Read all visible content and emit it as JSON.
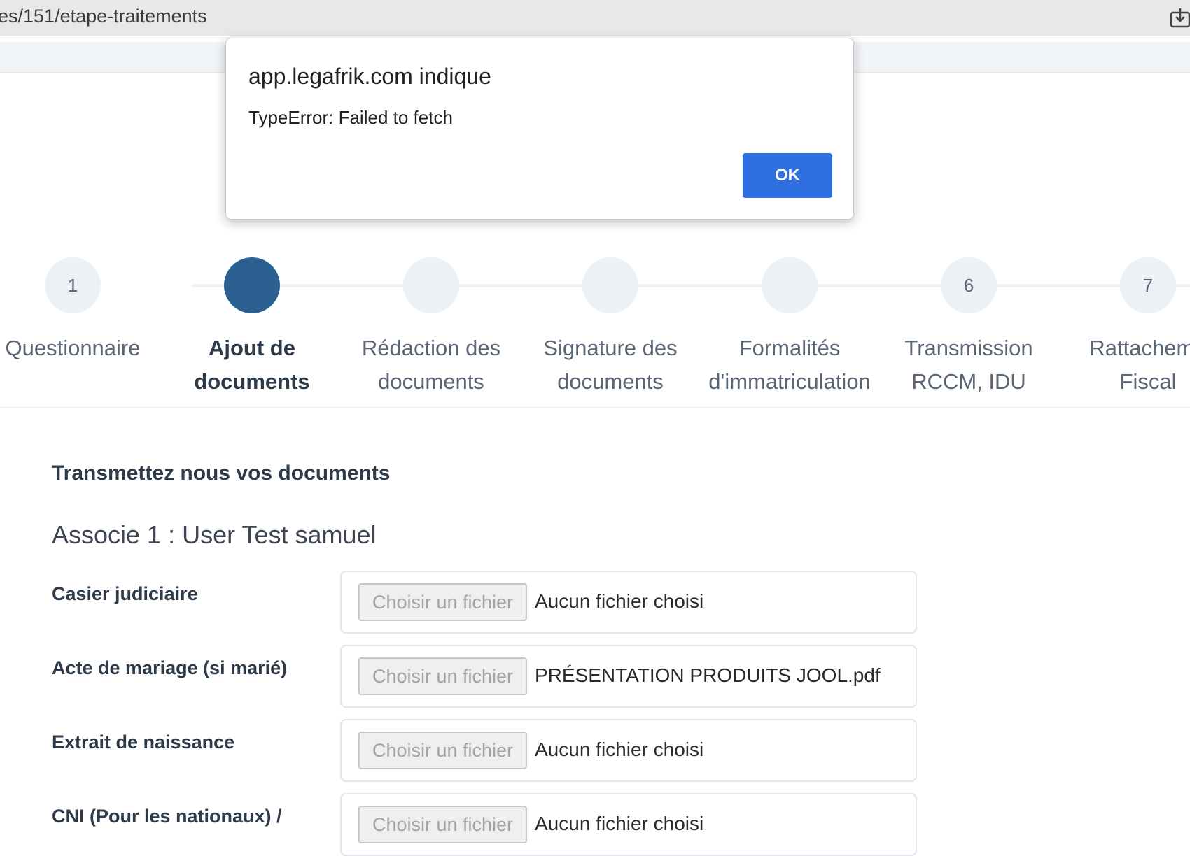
{
  "browser": {
    "url": "es/151/etape-traitements",
    "download_icon": "download-tray-icon"
  },
  "dialog": {
    "title": "app.legafrik.com indique",
    "message": "TypeError: Failed to fetch",
    "ok_label": "OK",
    "ok_color": "#2f6fdf"
  },
  "stepper": {
    "active_color": "#2a5f8f",
    "steps": [
      {
        "number": "1",
        "line1": "Questionnaire",
        "line2": "",
        "state": "completed"
      },
      {
        "number": "",
        "line1": "Ajout de",
        "line2": "documents",
        "state": "active"
      },
      {
        "number": "",
        "line1": "Rédaction des",
        "line2": "documents",
        "state": "pending"
      },
      {
        "number": "",
        "line1": "Signature des",
        "line2": "documents",
        "state": "pending"
      },
      {
        "number": "",
        "line1": "Formalités",
        "line2": "d'immatriculation",
        "state": "pending"
      },
      {
        "number": "6",
        "line1": "Transmission",
        "line2": "RCCM, IDU",
        "state": "pending"
      },
      {
        "number": "7",
        "line1": "Rattacheme",
        "line2": "Fiscal",
        "state": "pending"
      }
    ]
  },
  "main": {
    "section_title": "Transmettez nous vos documents",
    "associate_title": "Associe 1 : User Test samuel",
    "documents": [
      {
        "label": "Casier judiciaire",
        "button": "Choisir un fichier",
        "file": "Aucun fichier choisi"
      },
      {
        "label": "Acte de mariage (si marié)",
        "button": "Choisir un fichier",
        "file": "PRÉSENTATION PRODUITS JOOL.pdf"
      },
      {
        "label": "Extrait de naissance",
        "button": "Choisir un fichier",
        "file": "Aucun fichier choisi"
      },
      {
        "label": "CNI (Pour les nationaux) /",
        "button": "Choisir un fichier",
        "file": "Aucun fichier choisi"
      }
    ]
  }
}
